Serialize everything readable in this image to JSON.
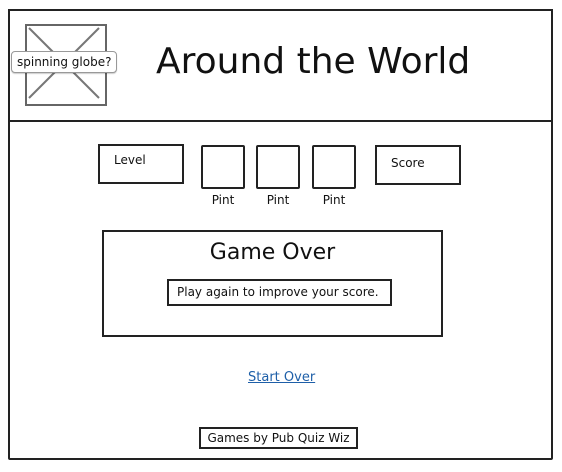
{
  "header": {
    "image_placeholder": {
      "icon": "image-placeholder-icon",
      "tooltip": "spinning globe?"
    },
    "title": "Around the World"
  },
  "stats": {
    "level_label": "Level",
    "score_label": "Score",
    "pints": [
      {
        "label": "Pint"
      },
      {
        "label": "Pint"
      },
      {
        "label": "Pint"
      }
    ]
  },
  "panel": {
    "title": "Game Over",
    "message": "Play again to improve your score."
  },
  "actions": {
    "start_over_label": "Start Over"
  },
  "footer": {
    "label": "Games by Pub Quiz Wiz"
  },
  "colors": {
    "link": "#1e5fa8",
    "border": "#222222",
    "placeholder": "#666666"
  }
}
